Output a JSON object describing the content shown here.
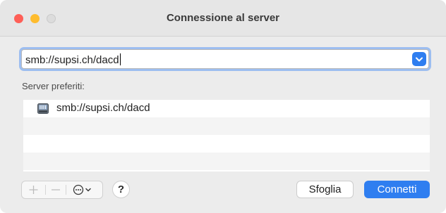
{
  "window": {
    "title": "Connessione al server",
    "traffic_lights": {
      "close_color": "#fe5f57",
      "minimize_color": "#febc2e",
      "zoom_color": "#dcdcdc"
    }
  },
  "server_address": {
    "value": "smb://supsi.ch/dacd",
    "dropdown_icon": "chevron-down-icon"
  },
  "favorites": {
    "label": "Server preferiti:",
    "items": [
      {
        "label": "smb://supsi.ch/dacd",
        "icon": "network-server-icon"
      }
    ]
  },
  "toolbar": {
    "add_icon": "plus-icon",
    "remove_icon": "minus-icon",
    "more_icon": "ellipsis-circle-icon",
    "help_label": "?",
    "browse_label": "Sfoglia",
    "connect_label": "Connetti"
  },
  "colors": {
    "accent": "#2f7ef0",
    "focus_ring": "#9dbef0"
  }
}
